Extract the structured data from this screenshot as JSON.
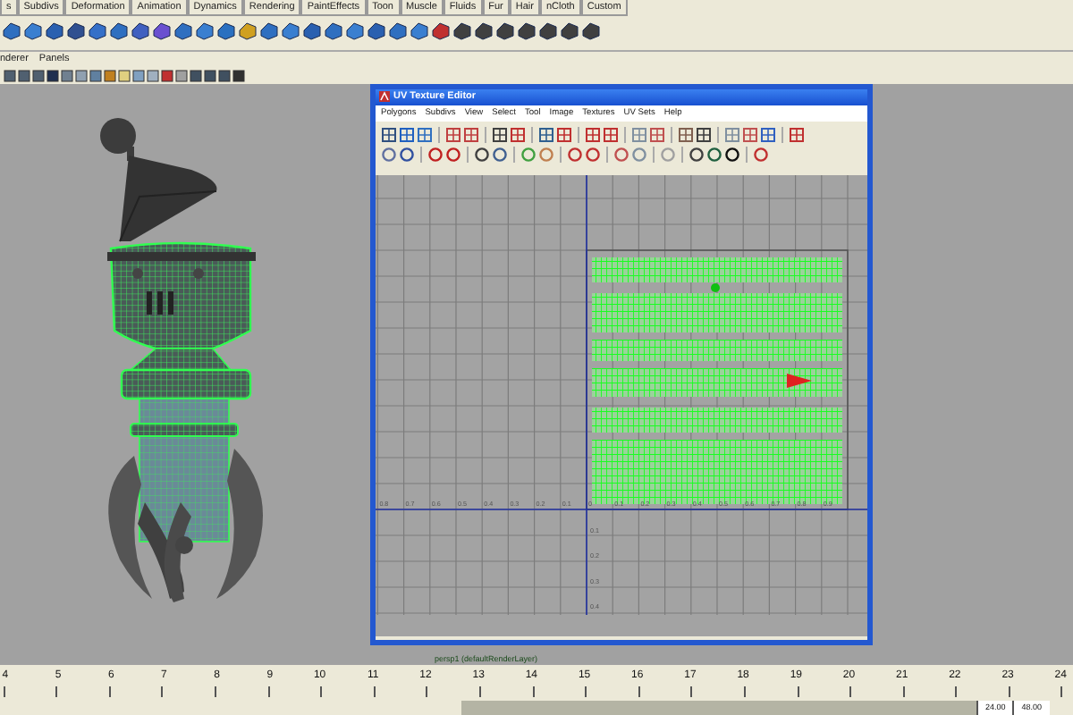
{
  "shelf_tabs": [
    {
      "label": "s"
    },
    {
      "label": "Subdivs"
    },
    {
      "label": "Deformation"
    },
    {
      "label": "Animation"
    },
    {
      "label": "Dynamics"
    },
    {
      "label": "Rendering"
    },
    {
      "label": "PaintEffects"
    },
    {
      "label": "Toon"
    },
    {
      "label": "Muscle"
    },
    {
      "label": "Fluids"
    },
    {
      "label": "Fur"
    },
    {
      "label": "Hair"
    },
    {
      "label": "nCloth"
    },
    {
      "label": "Custom"
    }
  ],
  "panel_menu": [
    "nderer",
    "Panels"
  ],
  "uv_editor": {
    "title": "UV Texture Editor",
    "menu": [
      "Polygons",
      "Subdivs",
      "View",
      "Select",
      "Tool",
      "Image",
      "Textures",
      "UV Sets",
      "Help"
    ],
    "u_labels": [
      "0.8",
      "0.7",
      "0.6",
      "0.5",
      "0.4",
      "0.3",
      "0.2",
      "0.1",
      "0",
      "0.1",
      "0.2",
      "0.3",
      "0.4",
      "0.5",
      "0.6",
      "0.7",
      "0.8",
      "0.9"
    ],
    "v_labels": [
      "0.1",
      "0.2",
      "0.3",
      "0.4"
    ]
  },
  "camera_label": "persp1 (defaultRenderLayer)",
  "timeline": {
    "frames": [
      "4",
      "5",
      "6",
      "7",
      "8",
      "9",
      "10",
      "11",
      "12",
      "13",
      "14",
      "15",
      "16",
      "17",
      "18",
      "19",
      "20",
      "21",
      "22",
      "23",
      "24"
    ]
  },
  "range_bar": {
    "end_time": "24.00",
    "max_time": "48.00"
  }
}
